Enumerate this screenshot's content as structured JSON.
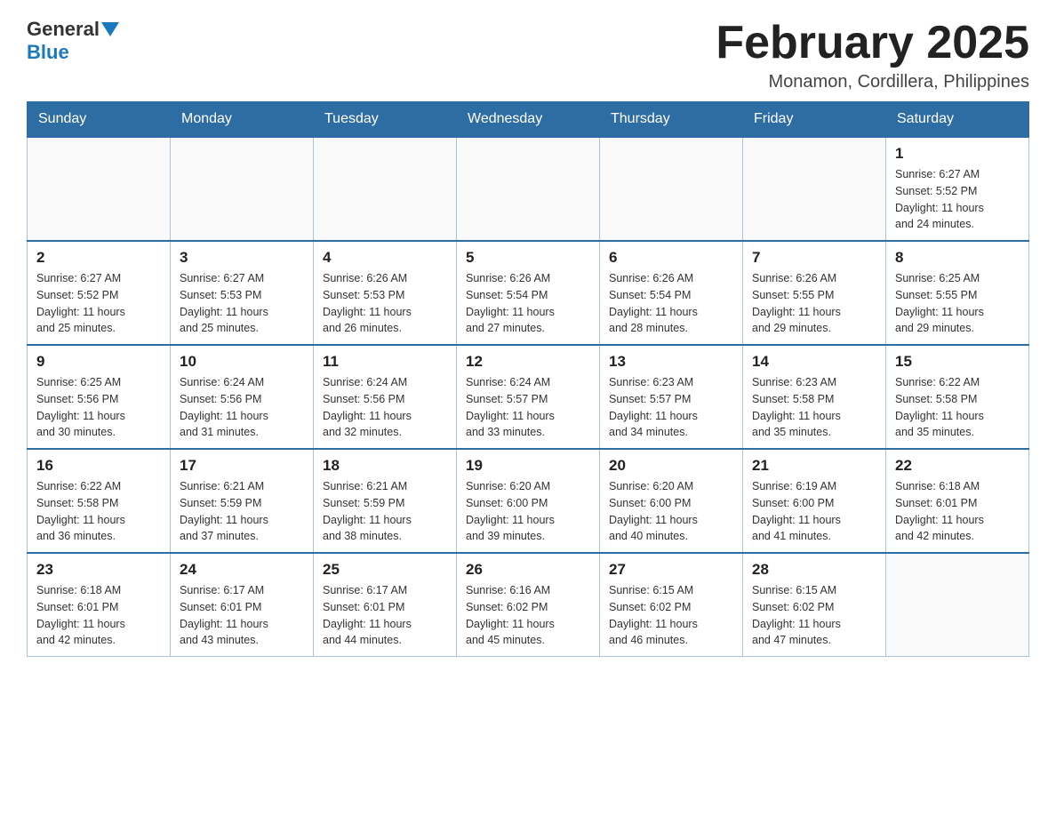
{
  "header": {
    "logo": {
      "general": "General",
      "blue": "Blue"
    },
    "title": "February 2025",
    "location": "Monamon, Cordillera, Philippines"
  },
  "weekdays": [
    "Sunday",
    "Monday",
    "Tuesday",
    "Wednesday",
    "Thursday",
    "Friday",
    "Saturday"
  ],
  "weeks": [
    {
      "days": [
        {
          "num": "",
          "info": ""
        },
        {
          "num": "",
          "info": ""
        },
        {
          "num": "",
          "info": ""
        },
        {
          "num": "",
          "info": ""
        },
        {
          "num": "",
          "info": ""
        },
        {
          "num": "",
          "info": ""
        },
        {
          "num": "1",
          "info": "Sunrise: 6:27 AM\nSunset: 5:52 PM\nDaylight: 11 hours\nand 24 minutes."
        }
      ]
    },
    {
      "days": [
        {
          "num": "2",
          "info": "Sunrise: 6:27 AM\nSunset: 5:52 PM\nDaylight: 11 hours\nand 25 minutes."
        },
        {
          "num": "3",
          "info": "Sunrise: 6:27 AM\nSunset: 5:53 PM\nDaylight: 11 hours\nand 25 minutes."
        },
        {
          "num": "4",
          "info": "Sunrise: 6:26 AM\nSunset: 5:53 PM\nDaylight: 11 hours\nand 26 minutes."
        },
        {
          "num": "5",
          "info": "Sunrise: 6:26 AM\nSunset: 5:54 PM\nDaylight: 11 hours\nand 27 minutes."
        },
        {
          "num": "6",
          "info": "Sunrise: 6:26 AM\nSunset: 5:54 PM\nDaylight: 11 hours\nand 28 minutes."
        },
        {
          "num": "7",
          "info": "Sunrise: 6:26 AM\nSunset: 5:55 PM\nDaylight: 11 hours\nand 29 minutes."
        },
        {
          "num": "8",
          "info": "Sunrise: 6:25 AM\nSunset: 5:55 PM\nDaylight: 11 hours\nand 29 minutes."
        }
      ]
    },
    {
      "days": [
        {
          "num": "9",
          "info": "Sunrise: 6:25 AM\nSunset: 5:56 PM\nDaylight: 11 hours\nand 30 minutes."
        },
        {
          "num": "10",
          "info": "Sunrise: 6:24 AM\nSunset: 5:56 PM\nDaylight: 11 hours\nand 31 minutes."
        },
        {
          "num": "11",
          "info": "Sunrise: 6:24 AM\nSunset: 5:56 PM\nDaylight: 11 hours\nand 32 minutes."
        },
        {
          "num": "12",
          "info": "Sunrise: 6:24 AM\nSunset: 5:57 PM\nDaylight: 11 hours\nand 33 minutes."
        },
        {
          "num": "13",
          "info": "Sunrise: 6:23 AM\nSunset: 5:57 PM\nDaylight: 11 hours\nand 34 minutes."
        },
        {
          "num": "14",
          "info": "Sunrise: 6:23 AM\nSunset: 5:58 PM\nDaylight: 11 hours\nand 35 minutes."
        },
        {
          "num": "15",
          "info": "Sunrise: 6:22 AM\nSunset: 5:58 PM\nDaylight: 11 hours\nand 35 minutes."
        }
      ]
    },
    {
      "days": [
        {
          "num": "16",
          "info": "Sunrise: 6:22 AM\nSunset: 5:58 PM\nDaylight: 11 hours\nand 36 minutes."
        },
        {
          "num": "17",
          "info": "Sunrise: 6:21 AM\nSunset: 5:59 PM\nDaylight: 11 hours\nand 37 minutes."
        },
        {
          "num": "18",
          "info": "Sunrise: 6:21 AM\nSunset: 5:59 PM\nDaylight: 11 hours\nand 38 minutes."
        },
        {
          "num": "19",
          "info": "Sunrise: 6:20 AM\nSunset: 6:00 PM\nDaylight: 11 hours\nand 39 minutes."
        },
        {
          "num": "20",
          "info": "Sunrise: 6:20 AM\nSunset: 6:00 PM\nDaylight: 11 hours\nand 40 minutes."
        },
        {
          "num": "21",
          "info": "Sunrise: 6:19 AM\nSunset: 6:00 PM\nDaylight: 11 hours\nand 41 minutes."
        },
        {
          "num": "22",
          "info": "Sunrise: 6:18 AM\nSunset: 6:01 PM\nDaylight: 11 hours\nand 42 minutes."
        }
      ]
    },
    {
      "days": [
        {
          "num": "23",
          "info": "Sunrise: 6:18 AM\nSunset: 6:01 PM\nDaylight: 11 hours\nand 42 minutes."
        },
        {
          "num": "24",
          "info": "Sunrise: 6:17 AM\nSunset: 6:01 PM\nDaylight: 11 hours\nand 43 minutes."
        },
        {
          "num": "25",
          "info": "Sunrise: 6:17 AM\nSunset: 6:01 PM\nDaylight: 11 hours\nand 44 minutes."
        },
        {
          "num": "26",
          "info": "Sunrise: 6:16 AM\nSunset: 6:02 PM\nDaylight: 11 hours\nand 45 minutes."
        },
        {
          "num": "27",
          "info": "Sunrise: 6:15 AM\nSunset: 6:02 PM\nDaylight: 11 hours\nand 46 minutes."
        },
        {
          "num": "28",
          "info": "Sunrise: 6:15 AM\nSunset: 6:02 PM\nDaylight: 11 hours\nand 47 minutes."
        },
        {
          "num": "",
          "info": ""
        }
      ]
    }
  ]
}
